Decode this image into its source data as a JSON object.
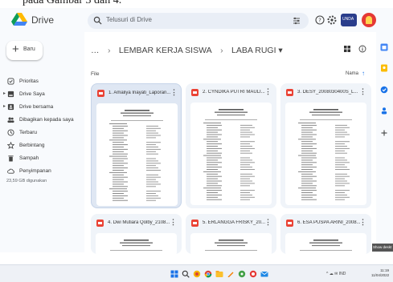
{
  "caption": "pada Gambar 3 dan 4.",
  "header": {
    "app_title": "Drive",
    "search_placeholder": "Telusuri di Drive"
  },
  "sidebar": {
    "new_label": "Baru",
    "items": [
      {
        "label": "Prioritas",
        "icon": "priority-icon",
        "expand": false
      },
      {
        "label": "Drive Saya",
        "icon": "my-drive-icon",
        "expand": true
      },
      {
        "label": "Drive bersama",
        "icon": "shared-drive-icon",
        "expand": true
      },
      {
        "label": "Dibagikan kepada saya",
        "icon": "shared-with-me-icon",
        "expand": false
      },
      {
        "label": "Terbaru",
        "icon": "clock-icon",
        "expand": false
      },
      {
        "label": "Berbintang",
        "icon": "star-icon",
        "expand": false
      },
      {
        "label": "Sampah",
        "icon": "trash-icon",
        "expand": false
      },
      {
        "label": "Penyimpanan",
        "icon": "cloud-icon",
        "expand": false
      }
    ],
    "storage": "23,59 GB digunakan"
  },
  "breadcrumb": {
    "ellipsis": "…",
    "sep": "›",
    "folder": "LEMBAR KERJA SISWA",
    "current": "LABA RUGI ▾"
  },
  "main": {
    "section": "File",
    "sort": "Nama"
  },
  "files": [
    {
      "name": "1. Amaliya Inayati_Laporan...",
      "selected": true
    },
    {
      "name": "2. CYNDIKA PUTRI MAULI...",
      "selected": false
    },
    {
      "name": "3. DESY_2008030400S_L...",
      "selected": false
    },
    {
      "name": "4. Dwi Mutiara Qolby_2108...",
      "selected": false
    },
    {
      "name": "5. ERLANGGA FRISKY_20...",
      "selected": false
    },
    {
      "name": "6. ESA PUSPA ARINI_2008...",
      "selected": false
    }
  ],
  "tooltip": "Show deskt",
  "taskbar": {
    "tray_text": "^ ☁ ✉ IND",
    "time": "11:19",
    "date": "11/04/2022"
  },
  "colors": {
    "accent": "#1a73e8",
    "pdf_red": "#ea4335",
    "surface": "#f8fafd",
    "card": "#f0f4f9"
  }
}
